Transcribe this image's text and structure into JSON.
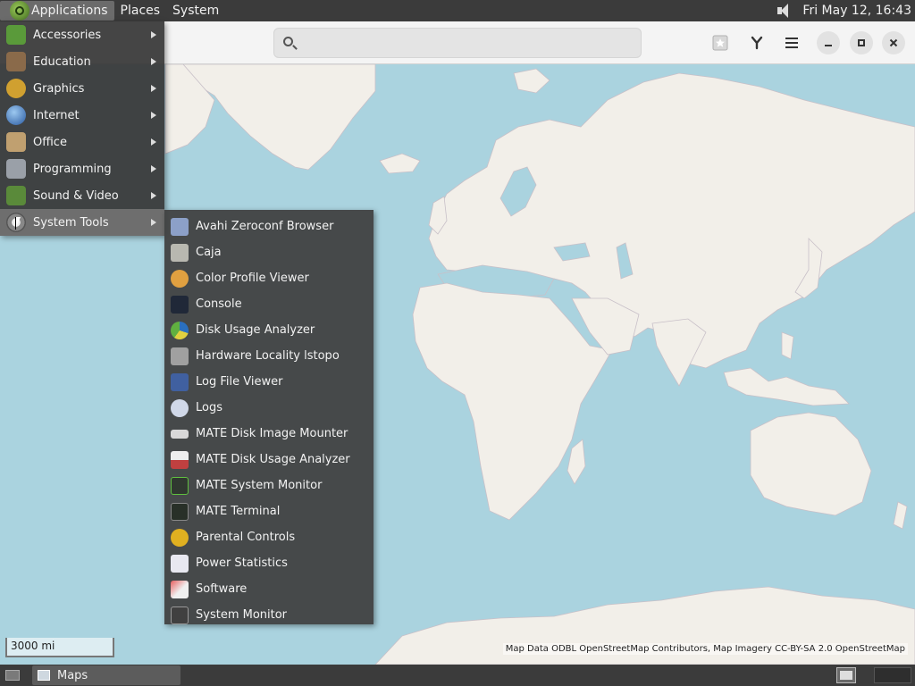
{
  "top_panel": {
    "applications_label": "Applications",
    "places_label": "Places",
    "system_label": "System",
    "clock": "Fri May 12, 16:43"
  },
  "app_menu": {
    "items": [
      {
        "label": "Accessories",
        "icon": "accessories-icon",
        "color": "#5a9a3a"
      },
      {
        "label": "Education",
        "icon": "education-icon",
        "color": "#8a6a4a"
      },
      {
        "label": "Graphics",
        "icon": "graphics-icon",
        "color": "#d0a030"
      },
      {
        "label": "Internet",
        "icon": "internet-icon",
        "color": "#3a70c0"
      },
      {
        "label": "Office",
        "icon": "office-icon",
        "color": "#c0a070"
      },
      {
        "label": "Programming",
        "icon": "programming-icon",
        "color": "#9aa0a8"
      },
      {
        "label": "Sound & Video",
        "icon": "sound-video-icon",
        "color": "#5a8a3a"
      },
      {
        "label": "System Tools",
        "icon": "system-tools-icon",
        "color": "#909090"
      }
    ]
  },
  "system_tools_menu": {
    "items": [
      {
        "label": "Avahi Zeroconf Browser",
        "icon": "avahi-icon",
        "color": "#8ca0c8"
      },
      {
        "label": "Caja",
        "icon": "caja-icon",
        "color": "#b8b8b0"
      },
      {
        "label": "Color Profile Viewer",
        "icon": "color-profile-icon",
        "color": "#e0a040"
      },
      {
        "label": "Console",
        "icon": "console-icon",
        "color": "#202838"
      },
      {
        "label": "Disk Usage Analyzer",
        "icon": "disk-usage-icon",
        "color": "#60b040"
      },
      {
        "label": "Hardware Locality lstopo",
        "icon": "hardware-icon",
        "color": "#a0a0a0"
      },
      {
        "label": "Log File Viewer",
        "icon": "log-viewer-icon",
        "color": "#4060a0"
      },
      {
        "label": "Logs",
        "icon": "logs-icon",
        "color": "#d0d8e8"
      },
      {
        "label": "MATE Disk Image Mounter",
        "icon": "disk-mounter-icon",
        "color": "#d8d8d8"
      },
      {
        "label": "MATE Disk Usage Analyzer",
        "icon": "mate-disk-usage-icon",
        "color": "#c04040"
      },
      {
        "label": "MATE System Monitor",
        "icon": "system-monitor-icon",
        "color": "#303830"
      },
      {
        "label": "MATE Terminal",
        "icon": "terminal-icon",
        "color": "#283028"
      },
      {
        "label": "Parental Controls",
        "icon": "parental-controls-icon",
        "color": "#e0b020"
      },
      {
        "label": "Power Statistics",
        "icon": "power-stats-icon",
        "color": "#e8e8f0"
      },
      {
        "label": "Software",
        "icon": "software-icon",
        "color": "#e86060"
      },
      {
        "label": "System Monitor",
        "icon": "system-monitor-2-icon",
        "color": "#404040"
      }
    ]
  },
  "maps": {
    "search_placeholder": "",
    "scale": "3000 mi",
    "attribution": "Map Data ODBL OpenStreetMap Contributors, Map Imagery CC-BY-SA 2.0 OpenStreetMap",
    "land_color": "#f2efe9",
    "water_color": "#aad3df"
  },
  "taskbar": {
    "window_label": "Maps"
  }
}
